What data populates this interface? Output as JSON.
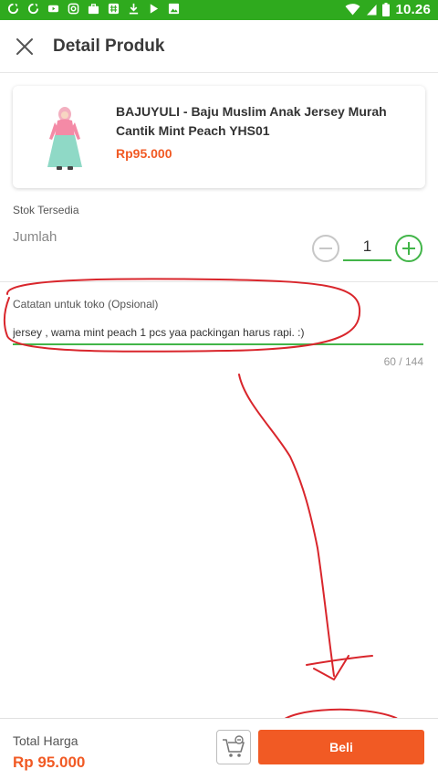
{
  "status_bar": {
    "time": "10.26",
    "left_icons": [
      "sync-icon",
      "sync-icon",
      "youtube-icon",
      "instagram-icon",
      "briefcase-icon",
      "hashtag-icon",
      "download-icon",
      "play-store-icon",
      "image-icon"
    ],
    "right_icons": [
      "wifi-icon",
      "signal-icon",
      "battery-icon"
    ]
  },
  "header": {
    "title": "Detail Produk",
    "close_icon": "close-icon"
  },
  "product": {
    "name": "BAJUYULI - Baju Muslim Anak Jersey Murah Cantik Mint Peach YHS01",
    "price": "Rp95.000"
  },
  "stock": {
    "label": "Stok Tersedia",
    "qty_label": "Jumlah",
    "qty_value": "1"
  },
  "note": {
    "label": "Catatan untuk toko (Opsional)",
    "value": "jersey , wama mint peach 1 pcs yaa packingan harus rapi. :)",
    "counter": "60 / 144"
  },
  "footer": {
    "total_label": "Total Harga",
    "total_value": "Rp 95.000",
    "buy_label": "Beli",
    "cart_icon": "cart-icon"
  },
  "colors": {
    "status_bar": "#2faa1e",
    "accent_green": "#42b549",
    "price_orange": "#f15a24",
    "annotation_red": "#d9262c"
  }
}
